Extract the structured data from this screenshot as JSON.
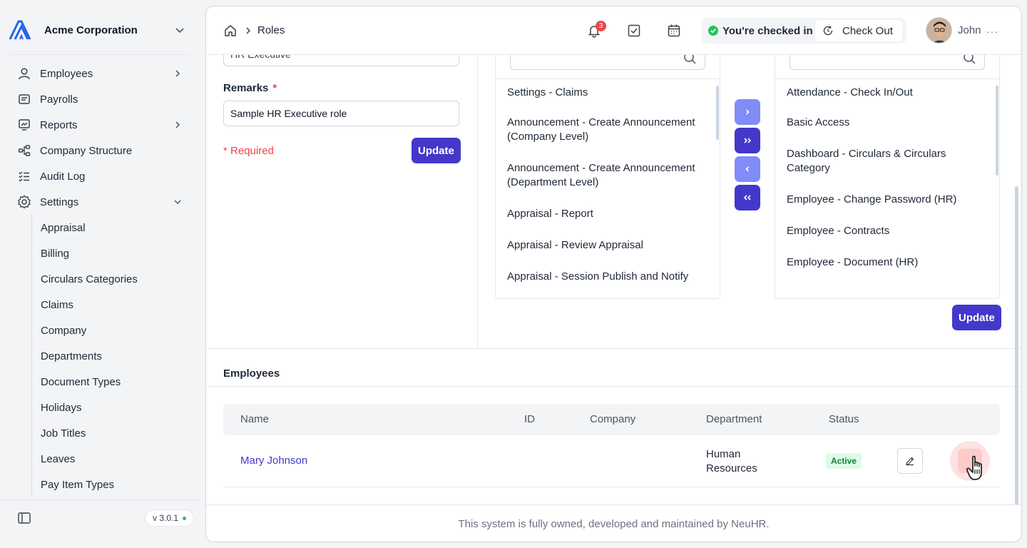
{
  "org": {
    "name": "Acme Corporation"
  },
  "nav": [
    {
      "label": "Employees",
      "icon": "user-icon",
      "chevron": "right"
    },
    {
      "label": "Payrolls",
      "icon": "payroll-icon",
      "chevron": ""
    },
    {
      "label": "Reports",
      "icon": "report-icon",
      "chevron": "right"
    },
    {
      "label": "Company Structure",
      "icon": "hierarchy-icon",
      "chevron": ""
    },
    {
      "label": "Audit Log",
      "icon": "checklist-icon",
      "chevron": ""
    },
    {
      "label": "Settings",
      "icon": "gear-icon",
      "chevron": "down"
    }
  ],
  "settings_sub": [
    "Appraisal",
    "Billing",
    "Circulars Categories",
    "Claims",
    "Company",
    "Departments",
    "Document Types",
    "Holidays",
    "Job Titles",
    "Leaves",
    "Pay Item Types"
  ],
  "version": "v 3.0.1",
  "header": {
    "breadcrumb": "Roles",
    "notification_count": "3",
    "checked_in": "You're checked in",
    "check_out": "Check Out",
    "user": "John",
    "more": "···"
  },
  "form": {
    "name_value": "HR Executive",
    "remarks_label": "Remarks",
    "required_star": "*",
    "remarks_value": "Sample HR Executive role",
    "required_note": "* Required",
    "update_label": "Update"
  },
  "permissions": {
    "available": [
      "Settings - Claims",
      "Announcement - Create Announcement (Company Level)",
      "Announcement - Create Announcement (Department Level)",
      "Appraisal - Report",
      "Appraisal - Review Appraisal",
      "Appraisal - Session Publish and Notify"
    ],
    "assigned": [
      "Attendance - Check In/Out",
      "Basic Access",
      "Dashboard - Circulars & Circulars Category",
      "Employee - Change Password (HR)",
      "Employee - Contracts",
      "Employee - Document (HR)"
    ],
    "update_label": "Update"
  },
  "employees": {
    "title": "Employees",
    "columns": [
      "Name",
      "ID",
      "Company",
      "Department",
      "Status"
    ],
    "rows": [
      {
        "name": "Mary Johnson",
        "id": "",
        "company": "",
        "department": "Human Resources",
        "status": "Active"
      }
    ]
  },
  "footer": "This system is fully owned, developed and maintained by NeuHR.",
  "colors": {
    "accent": "#4338ca",
    "accent_light": "#818cf8",
    "danger": "#ef4444",
    "success": "#22c55e"
  }
}
